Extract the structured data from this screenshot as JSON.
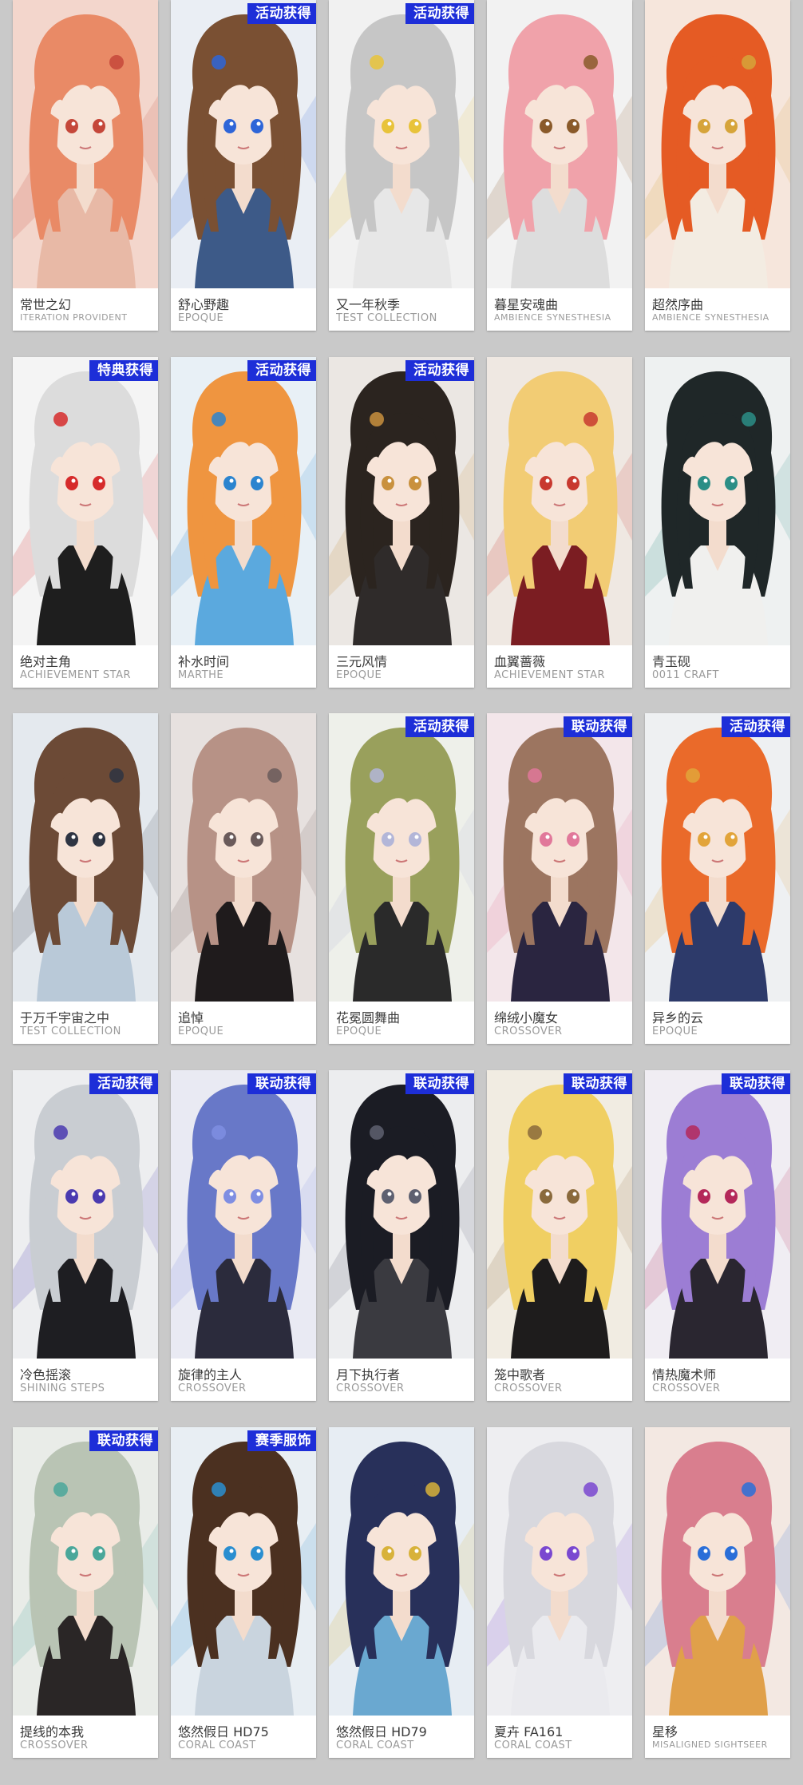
{
  "cards": [
    {
      "name": "常世之幻",
      "series": "ITERATION PROVIDENT",
      "badge": "",
      "hair": "#e98a66",
      "bg": "#f3d6cc",
      "outfit": "#e8b9a6",
      "accent": "#c5473a"
    },
    {
      "name": "舒心野趣",
      "series": "EPOQUE",
      "badge": "活动获得",
      "hair": "#7a5033",
      "bg": "#eaeef4",
      "outfit": "#3d5a88",
      "accent": "#2e65d8"
    },
    {
      "name": "又一年秋季",
      "series": "TEST COLLECTION",
      "badge": "活动获得",
      "hair": "#c6c6c6",
      "bg": "#f1f1f1",
      "outfit": "#e7e7e7",
      "accent": "#e8c33a"
    },
    {
      "name": "暮星安魂曲",
      "series": "AMBIENCE SYNESTHESIA",
      "badge": "",
      "hair": "#f0a2aa",
      "bg": "#f2f2f2",
      "outfit": "#dddddd",
      "accent": "#8a5a2a"
    },
    {
      "name": "超然序曲",
      "series": "AMBIENCE SYNESTHESIA",
      "badge": "",
      "hair": "#e55b24",
      "bg": "#f6e6dc",
      "outfit": "#f3ece2",
      "accent": "#d6a43a"
    },
    {
      "name": "绝对主角",
      "series": "ACHIEVEMENT STAR",
      "badge": "特典获得",
      "hair": "#dcdcdc",
      "bg": "#f4f4f4",
      "outfit": "#1e1e1e",
      "accent": "#d62b2b"
    },
    {
      "name": "补水时间",
      "series": "MARTHE",
      "badge": "活动获得",
      "hair": "#ef9540",
      "bg": "#e8f0f6",
      "outfit": "#5ba9de",
      "accent": "#2b84cf"
    },
    {
      "name": "三元风情",
      "series": "EPOQUE",
      "badge": "活动获得",
      "hair": "#2b241f",
      "bg": "#ebe7e3",
      "outfit": "#2f2b2a",
      "accent": "#c9913e"
    },
    {
      "name": "血翼蔷薇",
      "series": "ACHIEVEMENT STAR",
      "badge": "",
      "hair": "#f2cc74",
      "bg": "#efe8e2",
      "outfit": "#7b1d22",
      "accent": "#c8392f"
    },
    {
      "name": "青玉砚",
      "series": "0011 CRAFT",
      "badge": "",
      "hair": "#1f2728",
      "bg": "#eef1f1",
      "outfit": "#f0f0ee",
      "accent": "#2c8e86"
    },
    {
      "name": "于万千宇宙之中",
      "series": "TEST COLLECTION",
      "badge": "",
      "hair": "#6c4a36",
      "bg": "#e4e9ee",
      "outfit": "#b9c9d8",
      "accent": "#2e3442"
    },
    {
      "name": "追悼",
      "series": "EPOQUE",
      "badge": "",
      "hair": "#b79286",
      "bg": "#e7e1df",
      "outfit": "#1f1b1c",
      "accent": "#6a5a5a"
    },
    {
      "name": "花冕圆舞曲",
      "series": "EPOQUE",
      "badge": "活动获得",
      "hair": "#99a05c",
      "bg": "#eef0ea",
      "outfit": "#2a2a2a",
      "accent": "#b3b6d8"
    },
    {
      "name": "绵绒小魔女",
      "series": "CROSSOVER",
      "badge": "联动获得",
      "hair": "#9c7560",
      "bg": "#f3e6ea",
      "outfit": "#2a2540",
      "accent": "#e1789a"
    },
    {
      "name": "异乡的云",
      "series": "EPOQUE",
      "badge": "活动获得",
      "hair": "#ea6a2a",
      "bg": "#eef0f2",
      "outfit": "#2d3a6a",
      "accent": "#e2a43a"
    },
    {
      "name": "冷色摇滚",
      "series": "SHINING STEPS",
      "badge": "活动获得",
      "hair": "#c9cdd2",
      "bg": "#edeef0",
      "outfit": "#1e1e22",
      "accent": "#4a3ab0"
    },
    {
      "name": "旋律的主人",
      "series": "CROSSOVER",
      "badge": "联动获得",
      "hair": "#6878c8",
      "bg": "#e9eaf3",
      "outfit": "#2b2b3c",
      "accent": "#7f8ee2"
    },
    {
      "name": "月下执行者",
      "series": "CROSSOVER",
      "badge": "联动获得",
      "hair": "#1b1c24",
      "bg": "#ecedef",
      "outfit": "#3a3a40",
      "accent": "#5e6070"
    },
    {
      "name": "笼中歌者",
      "series": "CROSSOVER",
      "badge": "联动获得",
      "hair": "#f0cf62",
      "bg": "#f1ece2",
      "outfit": "#1e1c1c",
      "accent": "#8a6a3c"
    },
    {
      "name": "情热魔术师",
      "series": "CROSSOVER",
      "badge": "联动获得",
      "hair": "#9c7dd4",
      "bg": "#f0edf3",
      "outfit": "#2a2630",
      "accent": "#b4285a"
    },
    {
      "name": "提线的本我",
      "series": "CROSSOVER",
      "badge": "联动获得",
      "hair": "#b9c4b4",
      "bg": "#e9ece8",
      "outfit": "#2a2626",
      "accent": "#4aa79a"
    },
    {
      "name": "悠然假日 HD75",
      "series": "CORAL COAST",
      "badge": "赛季服饰",
      "hair": "#4b3020",
      "bg": "#e8eef3",
      "outfit": "#c9d4de",
      "accent": "#2a8ed0"
    },
    {
      "name": "悠然假日 HD79",
      "series": "CORAL COAST",
      "badge": "",
      "hair": "#28305a",
      "bg": "#e7edf3",
      "outfit": "#6aa8d0",
      "accent": "#d8b23a"
    },
    {
      "name": "夏卉 FA161",
      "series": "CORAL COAST",
      "badge": "",
      "hair": "#d8d8de",
      "bg": "#eeeef1",
      "outfit": "#eaeaee",
      "accent": "#7a48d0"
    },
    {
      "name": "星移",
      "series": "MISALIGNED SIGHTSEER",
      "badge": "",
      "hair": "#d97e8e",
      "bg": "#f3e8e2",
      "outfit": "#e0a04a",
      "accent": "#2a6ed8"
    }
  ]
}
